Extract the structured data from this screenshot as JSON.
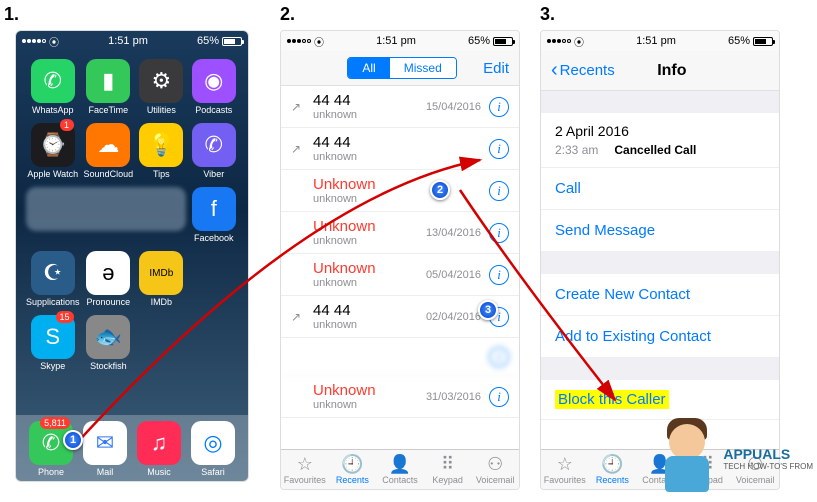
{
  "steps": {
    "s1": "1.",
    "s2": "2.",
    "s3": "3."
  },
  "status": {
    "time": "1:51 pm",
    "batt": "65%"
  },
  "home_apps_row1": [
    {
      "label": "WhatsApp",
      "bg": "#25d366",
      "glyph": "✆"
    },
    {
      "label": "FaceTime",
      "bg": "#34c759",
      "glyph": "▮"
    },
    {
      "label": "Utilities",
      "bg": "#3a3a3c",
      "glyph": "⚙"
    },
    {
      "label": "Podcasts",
      "bg": "#9d50ff",
      "glyph": "◉"
    }
  ],
  "home_apps_row2": [
    {
      "label": "Apple Watch",
      "bg": "#1c1c1e",
      "glyph": "⌚",
      "badge": "1"
    },
    {
      "label": "SoundCloud",
      "bg": "#ff7700",
      "glyph": "☁"
    },
    {
      "label": "Tips",
      "bg": "#ffcc00",
      "glyph": "💡"
    },
    {
      "label": "Viber",
      "bg": "#7360f2",
      "glyph": "✆"
    }
  ],
  "home_apps_row3": [
    {
      "label": "Facebook",
      "bg": "#1877f2",
      "glyph": "f"
    }
  ],
  "home_apps_row4": [
    {
      "label": "Supplications",
      "bg": "#2a5c8a",
      "glyph": "☪"
    },
    {
      "label": "Pronounce",
      "bg": "#ffffff",
      "glyph": "ə",
      "fg": "#000"
    },
    {
      "label": "IMDb",
      "bg": "#f5c518",
      "glyph": "IMDb",
      "fg": "#000",
      "fs": "10px"
    }
  ],
  "home_apps_row5": [
    {
      "label": "Skype",
      "bg": "#00aff0",
      "glyph": "S",
      "badge": "15"
    },
    {
      "label": "Stockfish",
      "bg": "#888",
      "glyph": "🐟"
    }
  ],
  "dock": [
    {
      "label": "Phone",
      "bg": "#34c759",
      "glyph": "✆",
      "badge": "5,811"
    },
    {
      "label": "Mail",
      "bg": "#ffffff",
      "glyph": "✉",
      "fg": "#3478f6"
    },
    {
      "label": "Music",
      "bg": "#ff2d55",
      "glyph": "♫"
    },
    {
      "label": "Safari",
      "bg": "#ffffff",
      "glyph": "◎",
      "fg": "#007aff"
    }
  ],
  "recents": {
    "seg_all": "All",
    "seg_missed": "Missed",
    "edit": "Edit",
    "calls": [
      {
        "name": "44 44",
        "sub": "unknown",
        "date": "15/04/2016",
        "missed": false,
        "out": true
      },
      {
        "name": "44 44",
        "sub": "unknown",
        "date": "",
        "missed": false,
        "out": true
      },
      {
        "name": "Unknown",
        "sub": "unknown",
        "date": "",
        "missed": true,
        "out": false
      },
      {
        "name": "Unknown",
        "sub": "unknown",
        "date": "13/04/2016",
        "missed": true,
        "out": false
      },
      {
        "name": "Unknown",
        "sub": "unknown",
        "date": "05/04/2016",
        "missed": true,
        "out": false
      },
      {
        "name": "44 44",
        "sub": "unknown",
        "date": "02/04/2016",
        "missed": false,
        "out": true
      },
      {
        "name": "",
        "sub": "",
        "date": "",
        "missed": false,
        "out": false,
        "blur": true
      },
      {
        "name": "Unknown",
        "sub": "unknown",
        "date": "31/03/2016",
        "missed": true,
        "out": false
      }
    ]
  },
  "tabs": [
    {
      "label": "Favourites",
      "glyph": "☆"
    },
    {
      "label": "Recents",
      "glyph": "🕘",
      "active": true
    },
    {
      "label": "Contacts",
      "glyph": "👤"
    },
    {
      "label": "Keypad",
      "glyph": "⠿"
    },
    {
      "label": "Voicemail",
      "glyph": "⚇"
    }
  ],
  "info": {
    "back": "Recents",
    "title": "Info",
    "date": "2 April 2016",
    "time": "2:33 am",
    "status": "Cancelled Call",
    "call": "Call",
    "send": "Send Message",
    "create": "Create New Contact",
    "add": "Add to Existing Contact",
    "block": "Block this Caller"
  },
  "markers": {
    "m1": "1",
    "m2": "2",
    "m3": "3"
  },
  "watermark": {
    "brand": "APPUALS",
    "sub": "TECH HOW-TO'S FROM"
  }
}
